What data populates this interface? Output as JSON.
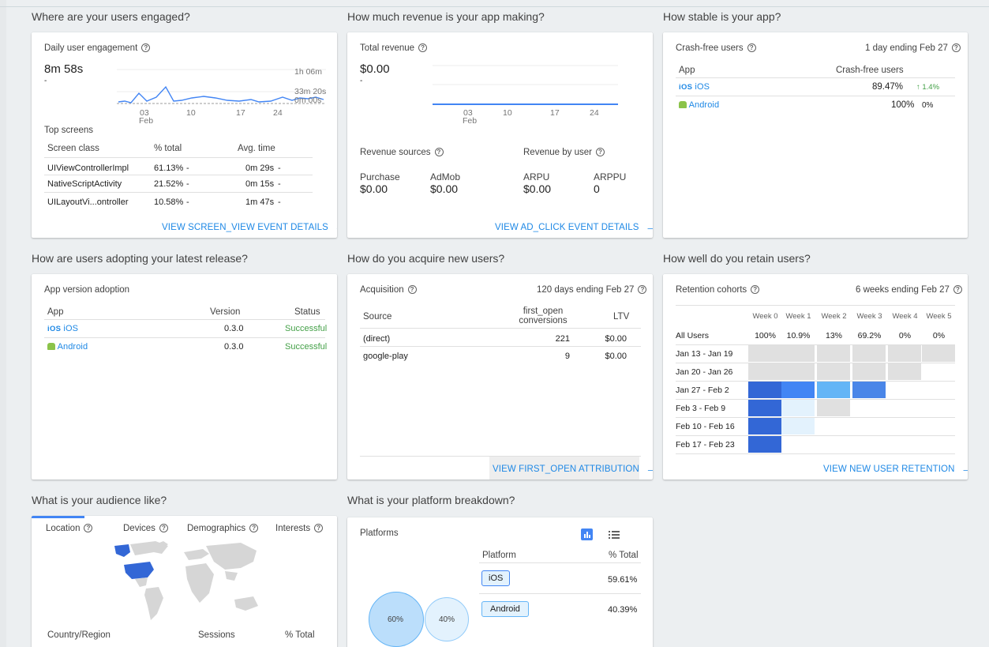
{
  "sections": {
    "engaged": "Where are your users engaged?",
    "revenue": "How much revenue is your app making?",
    "stable": "How stable is your app?",
    "adopting": "How are users adopting your latest release?",
    "acquire": "How do you acquire new users?",
    "retain": "How well do you retain users?",
    "audience": "What is your audience like?",
    "platform": "What is your platform breakdown?"
  },
  "engagement": {
    "title": "Daily user engagement",
    "value": "8m 58s",
    "delta": "-",
    "y_labels": [
      "1h 06m",
      "33m 20s",
      "0m 00s"
    ],
    "x_labels": [
      "03",
      "Feb",
      "10",
      "17",
      "24"
    ],
    "top_screens": "Top screens",
    "headers": [
      "Screen class",
      "% total",
      "Avg. time"
    ],
    "rows": [
      {
        "name": "UIViewControllerImpl",
        "pct": "61.13%",
        "pct_delta": "-",
        "time": "0m 29s",
        "time_delta": "-"
      },
      {
        "name": "NativeScriptActivity",
        "pct": "21.52%",
        "pct_delta": "-",
        "time": "0m 15s",
        "time_delta": "-"
      },
      {
        "name": "UILayoutVi...ontroller",
        "pct": "10.58%",
        "pct_delta": "-",
        "time": "1m 47s",
        "time_delta": "-"
      }
    ],
    "link": "VIEW SCREEN_VIEW EVENT DETAILS"
  },
  "revenue": {
    "title": "Total revenue",
    "value": "$0.00",
    "delta": "-",
    "x_labels": [
      "03",
      "Feb",
      "10",
      "17",
      "24"
    ],
    "sources_title": "Revenue sources",
    "by_user_title": "Revenue by user",
    "purchase_label": "Purchase",
    "purchase_value": "$0.00",
    "admob_label": "AdMob",
    "admob_value": "$0.00",
    "arpu_label": "ARPU",
    "arpu_value": "$0.00",
    "arppu_label": "ARPPU",
    "arppu_value": "0",
    "link": "VIEW AD_CLICK EVENT DETAILS"
  },
  "crash": {
    "title": "Crash-free users",
    "period": "1 day ending Feb 27",
    "col_app": "App",
    "col_value": "Crash-free users",
    "ios_icon": "iOS",
    "ios_label": "iOS",
    "ios_value": "89.47%",
    "ios_change": "↑ 1.4%",
    "android_label": "Android",
    "android_value": "100%",
    "android_change": "0%"
  },
  "adoption": {
    "title": "App version adoption",
    "col_app": "App",
    "col_version": "Version",
    "col_status": "Status",
    "ios_icon": "iOS",
    "ios_label": "iOS",
    "ios_version": "0.3.0",
    "ios_status": "Successful",
    "android_label": "Android",
    "android_version": "0.3.0",
    "android_status": "Successful"
  },
  "acquisition": {
    "title": "Acquisition",
    "period": "120 days ending Feb 27",
    "col_source": "Source",
    "col_conv_1": "first_open",
    "col_conv_2": "conversions",
    "col_ltv": "LTV",
    "rows": [
      {
        "source": "(direct)",
        "conv": "221",
        "ltv": "$0.00"
      },
      {
        "source": "google-play",
        "conv": "9",
        "ltv": "$0.00"
      }
    ],
    "link": "VIEW FIRST_OPEN ATTRIBUTION"
  },
  "retention": {
    "title": "Retention cohorts",
    "period": "6 weeks ending Feb 27",
    "weeks": [
      "Week 0",
      "Week 1",
      "Week 2",
      "Week 3",
      "Week 4",
      "Week 5"
    ],
    "all_users_label": "All Users",
    "all_users": [
      "100%",
      "10.9%",
      "13%",
      "69.2%",
      "0%",
      "0%"
    ],
    "cohorts": [
      {
        "label": "Jan 13 - Jan 19",
        "cells": [
          "#e0e0e0",
          "#e0e0e0",
          "#e0e0e0",
          "#e0e0e0",
          "#e0e0e0",
          "#e0e0e0"
        ]
      },
      {
        "label": "Jan 20 - Jan 26",
        "cells": [
          "#e0e0e0",
          "#e0e0e0",
          "#e0e0e0",
          "#e0e0e0",
          "#e0e0e0"
        ]
      },
      {
        "label": "Jan 27 - Feb 2",
        "cells": [
          "#3367d6",
          "#4285f4",
          "#64b5f6",
          "#4a86e8"
        ]
      },
      {
        "label": "Feb 3 - Feb 9",
        "cells": [
          "#3367d6",
          "#e3f2fd",
          "#e0e0e0"
        ]
      },
      {
        "label": "Feb 10 - Feb 16",
        "cells": [
          "#3367d6",
          "#e3f2fd"
        ]
      },
      {
        "label": "Feb 17 - Feb 23",
        "cells": [
          "#3367d6"
        ]
      }
    ],
    "link": "VIEW NEW USER RETENTION"
  },
  "audience": {
    "tabs": [
      "Location",
      "Devices",
      "Demographics",
      "Interests"
    ],
    "col_country": "Country/Region",
    "col_sessions": "Sessions",
    "col_total": "% Total"
  },
  "platforms": {
    "title": "Platforms",
    "col_platform": "Platform",
    "col_total": "% Total",
    "ios_chip": "iOS",
    "ios_value": "59.61%",
    "android_chip": "Android",
    "android_value": "40.39%",
    "bubble_ios": "60%",
    "bubble_android": "40%"
  }
}
